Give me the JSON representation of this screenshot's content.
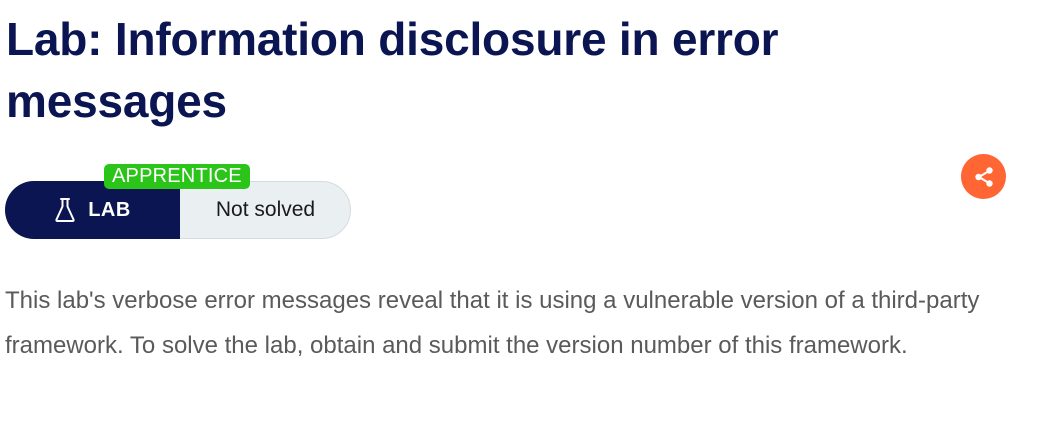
{
  "page": {
    "title": "Lab: Information disclosure in error messages"
  },
  "lab_widget": {
    "level": "APPRENTICE",
    "badge_label": "LAB",
    "badge_icon": "flask-icon",
    "status": "Not solved",
    "colors": {
      "badge_bg": "#0a1551",
      "level_bg": "#2bc419",
      "status_bg": "#eaeff2"
    }
  },
  "share": {
    "icon": "share-icon",
    "color": "#ff6633"
  },
  "description": "This lab's verbose error messages reveal that it is using a vulnerable version of a third-party framework. To solve the lab, obtain and submit the version number of this framework."
}
